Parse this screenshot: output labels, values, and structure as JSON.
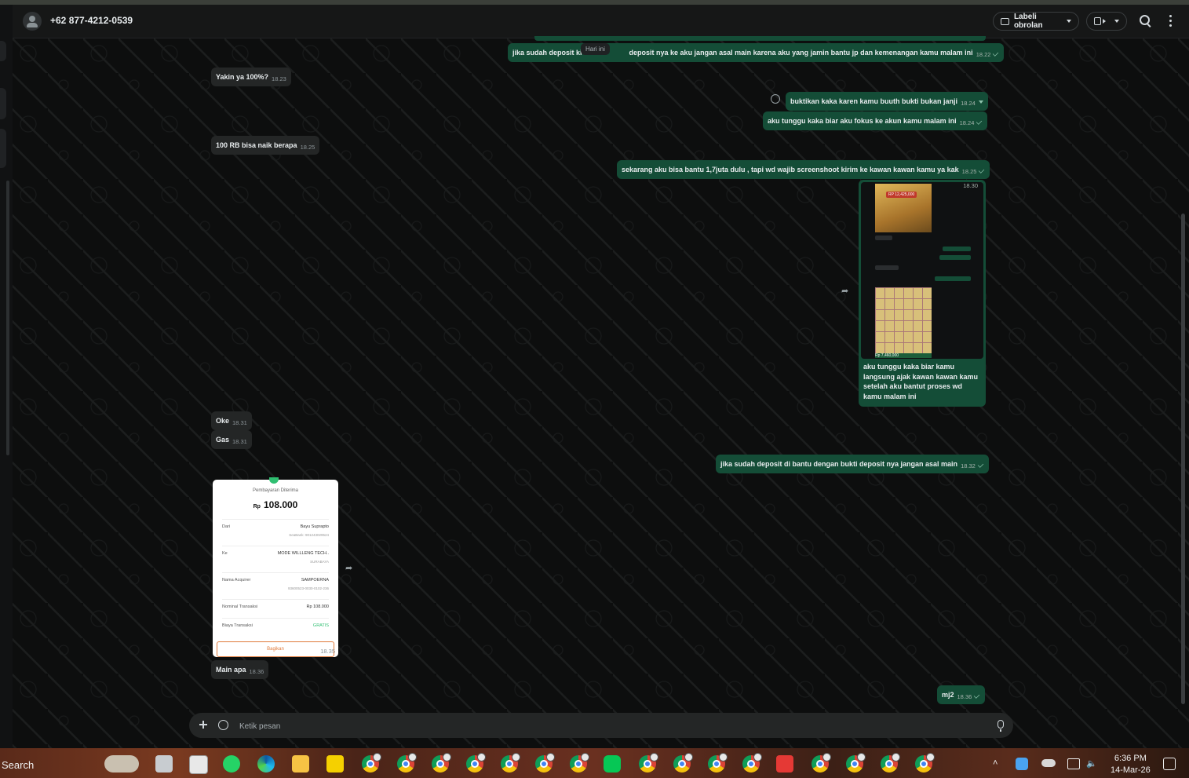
{
  "header": {
    "contact_name": "+62 877-4212-0539",
    "label_button": "Labeli obrolan"
  },
  "date_divider": "Hari ini",
  "messages": [
    {
      "dir": "out",
      "text": "jika sudah deposit ki",
      "text2": "deposit nya ke aku jangan asal main karena aku yang jamin bantu jp dan kemenangan kamu malam ini",
      "time": "18.22"
    },
    {
      "dir": "in",
      "text": "Yakin ya 100%?",
      "time": "18.23"
    },
    {
      "dir": "out",
      "text": "buktikan kaka karen kamu buuth bukti bukan janji",
      "time": "18.24"
    },
    {
      "dir": "out",
      "text": "aku tunggu kaka biar aku fokus ke akun kamu malam ini",
      "time": "18.24"
    },
    {
      "dir": "in",
      "text": "100 RB bisa naik berapa",
      "time": "18.25"
    },
    {
      "dir": "out",
      "text": "sekarang aku bisa bantu 1,7juta dulu , tapi wd wajib screenshoot kirim ke kawan kawan kamu ya kak",
      "time": "18.25"
    },
    {
      "dir": "out",
      "text": "aku tunggu kaka biar kamu langsung ajak kawan kawan kamu setelah aku bantut proses wd kamu malam ini",
      "time": "18.30"
    },
    {
      "dir": "in",
      "text": "Oke",
      "time": "18.31"
    },
    {
      "dir": "in",
      "text": "Gas",
      "time": "18.31"
    },
    {
      "dir": "out",
      "text": "jika sudah deposit di bantu dengan bukti deposit nya jangan asal main",
      "time": "18.32"
    },
    {
      "dir": "in",
      "text": "Main apa",
      "time": "18.36"
    },
    {
      "dir": "out",
      "text": "mj2",
      "time": "18.36"
    }
  ],
  "media_shot": {
    "win_amount": "RP 12,425,000",
    "win_amount2": "Rp 7,460,000"
  },
  "receipt": {
    "title": "Pembayaran Diterima",
    "currency": "Rp",
    "amount": "108.000",
    "rows": [
      {
        "k": "Dari",
        "v": "Bayu Suprapto",
        "s": "SeaBank: 901243029524"
      },
      {
        "k": "Ke",
        "v": "MODE WILLLENG TECH..",
        "s": "SURABAYA"
      },
      {
        "k": "Nama Acquirer",
        "v": "SAMPOERNA",
        "s": "93600523-0030-0102-236"
      },
      {
        "k": "Nominal Transaksi",
        "v": "Rp 108.000",
        "s": ""
      },
      {
        "k": "Biaya Transaksi",
        "v": "GRATIS",
        "s": ""
      }
    ],
    "button": "Bagikan",
    "time": "18.35"
  },
  "composer": {
    "placeholder": "Ketik pesan"
  },
  "taskbar": {
    "search_label": "Search",
    "time": "6:36 PM",
    "date": "14-Mar-26"
  },
  "colors": {
    "bubble_out": "#144d37",
    "bubble_in": "#242626",
    "background": "#0d0e0e"
  }
}
